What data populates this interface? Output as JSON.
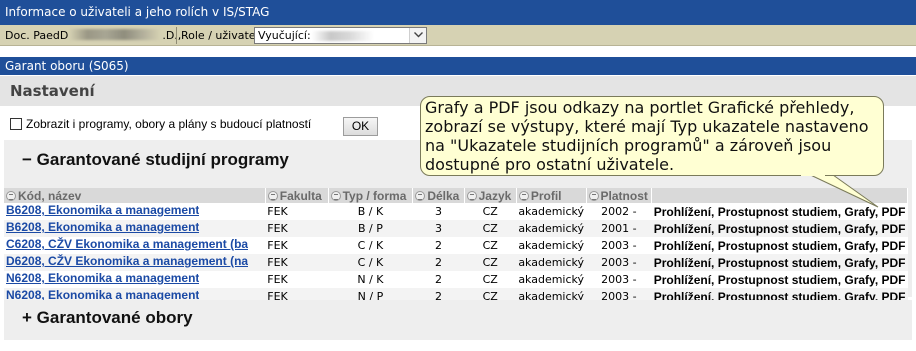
{
  "header": {
    "title": "Informace o uživateli a jeho rolích v IS/STAG",
    "user_name_prefix": "Doc. PaedD",
    "user_name_suffix": ".D.,",
    "role_label": "Role / uživatel",
    "role_value": "Vyučující:"
  },
  "portlet": {
    "title": "Garant oboru (S065)",
    "settings_title": "Nastavení",
    "option_label": "Zobrazit i programy, obory a plány s budoucí platností",
    "ok_label": "OK"
  },
  "sections": {
    "programs": {
      "toggle": "−",
      "title": "Garantované studijní programy"
    },
    "fields": {
      "toggle": "+",
      "title": "Garantované obory"
    }
  },
  "table": {
    "columns": [
      "Kód, název",
      "Fakulta",
      "Typ / forma",
      "Délka",
      "Jazyk",
      "Profil",
      "Platnost"
    ],
    "rows": [
      {
        "kod": "B6208, Ekonomika a management",
        "fakulta": "FEK",
        "typ": "B / K",
        "delka": "3",
        "jazyk": "CZ",
        "profil": "akademický",
        "platnost": "2002 -",
        "akce": "Prohlížení, Prostupnost studiem, Grafy, PDF"
      },
      {
        "kod": "B6208, Ekonomika a management",
        "fakulta": "FEK",
        "typ": "B / P",
        "delka": "3",
        "jazyk": "CZ",
        "profil": "akademický",
        "platnost": "2001 -",
        "akce": "Prohlížení, Prostupnost studiem, Grafy, PDF"
      },
      {
        "kod": "C6208, CŽV Ekonomika a management (ba",
        "fakulta": "FEK",
        "typ": "C / K",
        "delka": "2",
        "jazyk": "CZ",
        "profil": "akademický",
        "platnost": "2003 -",
        "akce": "Prohlížení, Prostupnost studiem, Grafy, PDF"
      },
      {
        "kod": "D6208, CŽV Ekonomika a management (na",
        "fakulta": "FEK",
        "typ": "C / K",
        "delka": "2",
        "jazyk": "CZ",
        "profil": "akademický",
        "platnost": "2003 -",
        "akce": "Prohlížení, Prostupnost studiem, Grafy, PDF"
      },
      {
        "kod": "N6208, Ekonomika a management",
        "fakulta": "FEK",
        "typ": "N / K",
        "delka": "2",
        "jazyk": "CZ",
        "profil": "akademický",
        "platnost": "2003 -",
        "akce": "Prohlížení, Prostupnost studiem, Grafy, PDF"
      },
      {
        "kod": "N6208, Ekonomika a management",
        "fakulta": "FEK",
        "typ": "N / P",
        "delka": "2",
        "jazyk": "CZ",
        "profil": "akademický",
        "platnost": "2003 -",
        "akce": "Prohlížení, Prostupnost studiem, Grafy, PDF"
      }
    ]
  },
  "callout": {
    "text": "Grafy a PDF jsou odkazy na portlet Grafické přehledy, zobrazí se výstupy, které mají Typ ukazatele nastaveno na \"Ukazatele studijních programů\" a zároveň jsou dostupné pro ostatní uživatele."
  },
  "colors": {
    "header_blue": "#1f4f99",
    "user_bar": "#d6d2b3",
    "link_blue": "#1b4aa5",
    "callout_bg": "#ffffd3"
  }
}
